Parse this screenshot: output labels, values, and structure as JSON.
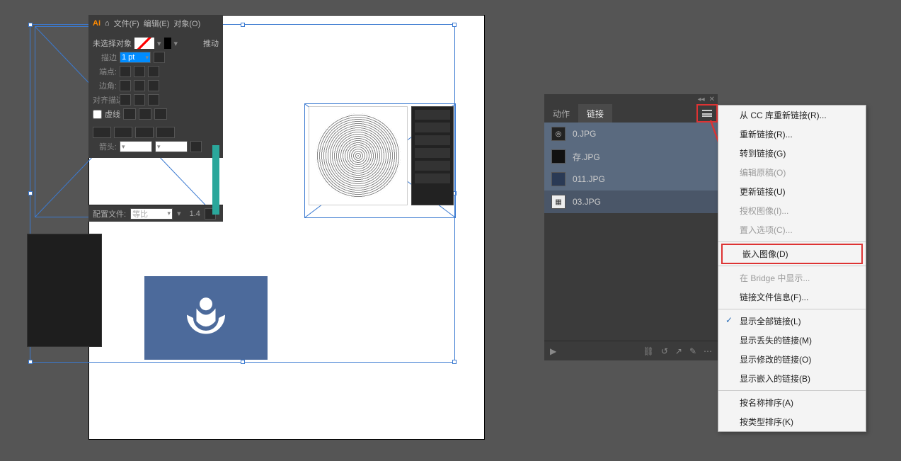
{
  "app": {
    "menu": [
      "文件(F)",
      "编辑(E)",
      "对象(O)"
    ]
  },
  "prop": {
    "title": "未选择对象",
    "rows": {
      "stroke": "描边",
      "cap": "端点:",
      "corner": "边角:",
      "align": "对齐描边:",
      "dashed": "虚线",
      "arrow": "箭头:",
      "profile": "配置文件:",
      "uniform": "等比"
    },
    "strokeVal": "1 pt",
    "scale": "1.4"
  },
  "control": {
    "dance": "推动"
  },
  "doc": {
    "lines": [
      "",
      "",
      "",
      "",
      ""
    ]
  },
  "panel": {
    "tabs": {
      "actions": "动作",
      "links": "链接"
    },
    "title_icons": {
      "collapse": "◂◂",
      "close": "✕"
    },
    "items": [
      {
        "name": "0.JPG",
        "thumb": "◎"
      },
      {
        "name": "存.JPG",
        "thumb": ""
      },
      {
        "name": "011.JPG",
        "thumb": ""
      },
      {
        "name": "03.JPG",
        "thumb": "▦"
      }
    ],
    "foot": {
      "nav": "▶",
      "i1": "⛓",
      "i2": "↺",
      "i3": "↗",
      "i4": "✎",
      "i5": "⋯"
    }
  },
  "menu": {
    "m1": "从 CC 库重新链接(R)...",
    "m2": "重新链接(R)...",
    "m3": "转到链接(G)",
    "m4": "编辑原稿(O)",
    "m5": "更新链接(U)",
    "m6": "授权图像(I)...",
    "m7": "置入选项(C)...",
    "m8": "嵌入图像(D)",
    "m9": "在 Bridge 中显示...",
    "m10": "链接文件信息(F)...",
    "m11": "显示全部链接(L)",
    "m12": "显示丢失的链接(M)",
    "m13": "显示修改的链接(O)",
    "m14": "显示嵌入的链接(B)",
    "m15": "按名称排序(A)",
    "m16": "按类型排序(K)"
  }
}
